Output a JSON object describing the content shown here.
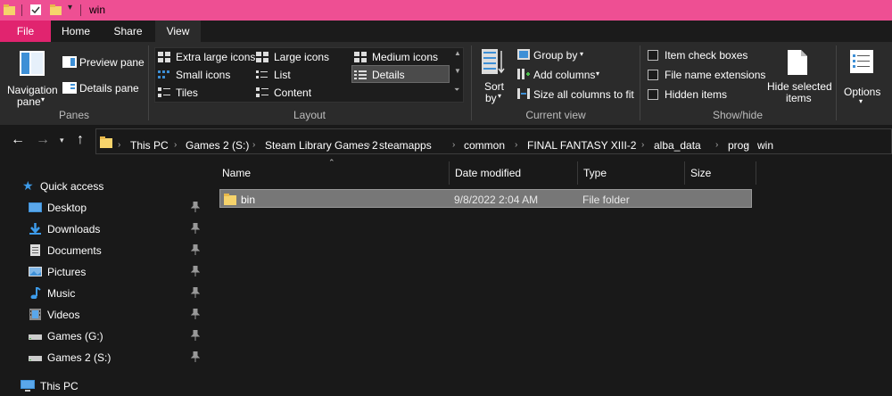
{
  "window": {
    "title": "win"
  },
  "ribbon_tabs": {
    "file": "File",
    "home": "Home",
    "share": "Share",
    "view": "View"
  },
  "panes": {
    "navigation_pane": "Navigation",
    "navigation_pane_2": "pane",
    "preview_pane": "Preview pane",
    "details_pane": "Details pane",
    "group_label": "Panes"
  },
  "layout": {
    "extra_large_icons": "Extra large icons",
    "large_icons": "Large icons",
    "medium_icons": "Medium icons",
    "small_icons": "Small icons",
    "list": "List",
    "details": "Details",
    "tiles": "Tiles",
    "content": "Content",
    "group_label": "Layout"
  },
  "current_view": {
    "sort_by": "Sort",
    "sort_by_2": "by",
    "group_by": "Group by",
    "add_columns": "Add columns",
    "size_all_columns": "Size all columns to fit",
    "group_label": "Current view"
  },
  "show_hide": {
    "item_check_boxes": "Item check boxes",
    "file_name_extensions": "File name extensions",
    "hidden_items": "Hidden items",
    "hide_selected_items": "Hide selected",
    "hide_selected_items_2": "items",
    "group_label": "Show/hide"
  },
  "options": {
    "label": "Options"
  },
  "breadcrumb": [
    "This PC",
    "Games 2 (S:)",
    "Steam Library Games 2",
    "steamapps",
    "common",
    "FINAL FANTASY XIII-2",
    "alba_data",
    "prog",
    "win"
  ],
  "nav_pane": {
    "quick_access": "Quick access",
    "items": [
      "Desktop",
      "Downloads",
      "Documents",
      "Pictures",
      "Music",
      "Videos",
      "Games (G:)",
      "Games 2 (S:)"
    ],
    "this_pc": "This PC"
  },
  "columns": {
    "name": "Name",
    "date_modified": "Date modified",
    "type": "Type",
    "size": "Size"
  },
  "files": [
    {
      "name": "bin",
      "date_modified": "9/8/2022 2:04 AM",
      "type": "File folder",
      "size": ""
    }
  ],
  "colors": {
    "title_bar": "#ee4f93",
    "file_tab": "#e1246f",
    "folder": "#f6d36b"
  }
}
